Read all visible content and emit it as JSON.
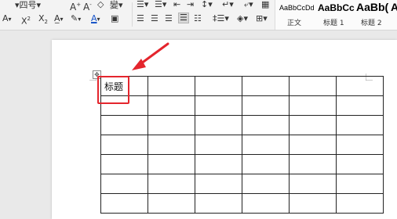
{
  "ribbon": {
    "font_size_value": "四号",
    "phonetic_label": "變",
    "style_gallery": [
      {
        "sample": "AaBbCcDd",
        "label": "正文"
      },
      {
        "sample": "AaBbCc",
        "label": "标题 1"
      },
      {
        "sample": "AaBb(",
        "label": "标题 2"
      },
      {
        "sample": "A",
        "label": ""
      }
    ]
  },
  "document": {
    "table": {
      "rows": 7,
      "cols": 6,
      "cells": [
        [
          "标题",
          "",
          "",
          "",
          "",
          ""
        ]
      ]
    }
  },
  "annotation": {
    "color": "#e4252d"
  }
}
